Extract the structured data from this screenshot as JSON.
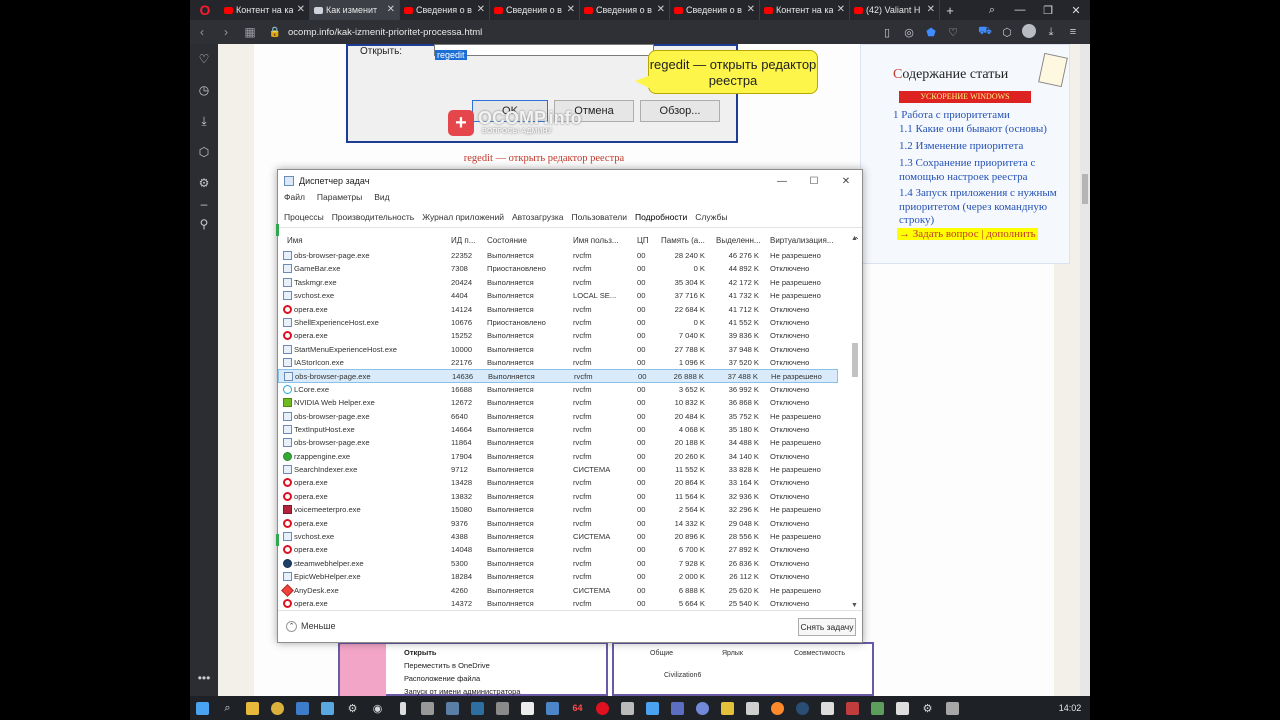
{
  "browser": {
    "tabs": [
      {
        "label": "Контент на ка",
        "kind": "youtube",
        "active": false
      },
      {
        "label": "Как изменит",
        "kind": "generic",
        "active": true
      },
      {
        "label": "Сведения о в",
        "kind": "youtube",
        "active": false
      },
      {
        "label": "Сведения о в",
        "kind": "youtube",
        "active": false
      },
      {
        "label": "Сведения о в",
        "kind": "youtube",
        "active": false
      },
      {
        "label": "Сведения о в",
        "kind": "youtube",
        "active": false
      },
      {
        "label": "Контент на ка",
        "kind": "youtube",
        "active": false
      },
      {
        "label": "(42) Valiant H",
        "kind": "youtube",
        "active": false
      }
    ],
    "url": "ocomp.info/kak-izmenit-prioritet-processa.html"
  },
  "article": {
    "run_dialog": {
      "open_label": "Открыть:",
      "input_value": "regedit",
      "ok_label": "OK",
      "cancel_label": "Отмена",
      "browse_label": "Обзор..."
    },
    "callout": "regedit — открыть редактор реестра",
    "watermark": {
      "name": "OCOMP.info",
      "sub": "ВОПРОСЫ АДМИНУ"
    },
    "caption": "regedit — открыть редактор реестра",
    "toc": {
      "title_first": "С",
      "title_rest": "одержание статьи",
      "banner": "УСКОРЕНИЕ WINDOWS",
      "items": [
        "1 Работа с приоритетами",
        "1.1 Какие они бывают (основы)",
        "1.2 Изменение приоритета",
        "1.3 Сохранение приоритета с помощью настроек реестра",
        "1.4 Запуск приложения с нужным приоритетом (через командную строку)"
      ],
      "ask": "→ Задать вопрос | дополнить"
    },
    "bottom_menu": [
      "Открыть",
      "Переместить в OneDrive",
      "Расположение файла",
      "Запуск от имени администратора"
    ],
    "bottom_tabs": [
      "Общие",
      "Ярлык",
      "Совместимость"
    ],
    "bottom_app": "Civilization6"
  },
  "task_manager": {
    "title": "Диспетчер задач",
    "menu": [
      "Файл",
      "Параметры",
      "Вид"
    ],
    "tabs": [
      "Процессы",
      "Производительность",
      "Журнал приложений",
      "Автозагрузка",
      "Пользователи",
      "Подробности",
      "Службы"
    ],
    "active_tab": "Подробности",
    "columns": [
      "Имя",
      "ИД п...",
      "Состояние",
      "Имя польз...",
      "ЦП",
      "Память (а...",
      "Выделенн...",
      "Виртуализация..."
    ],
    "rows": [
      {
        "name": "obs-browser-page.exe",
        "pid": "22352",
        "state": "Выполняется",
        "user": "rvcfm",
        "cpu": "00",
        "mem": "28 240 K",
        "commit": "46 276 K",
        "virt": "Не разрешено",
        "icon": "app"
      },
      {
        "name": "GameBar.exe",
        "pid": "7308",
        "state": "Приостановлено",
        "user": "rvcfm",
        "cpu": "00",
        "mem": "0 K",
        "commit": "44 892 K",
        "virt": "Отключено",
        "icon": "app"
      },
      {
        "name": "Taskmgr.exe",
        "pid": "20424",
        "state": "Выполняется",
        "user": "rvcfm",
        "cpu": "00",
        "mem": "35 304 K",
        "commit": "42 172 K",
        "virt": "Не разрешено",
        "icon": "app"
      },
      {
        "name": "svchost.exe",
        "pid": "4404",
        "state": "Выполняется",
        "user": "LOCAL SE...",
        "cpu": "00",
        "mem": "37 716 K",
        "commit": "41 732 K",
        "virt": "Не разрешено",
        "icon": "app"
      },
      {
        "name": "opera.exe",
        "pid": "14124",
        "state": "Выполняется",
        "user": "rvcfm",
        "cpu": "00",
        "mem": "22 684 K",
        "commit": "41 712 K",
        "virt": "Отключено",
        "icon": "opera"
      },
      {
        "name": "ShellExperienceHost.exe",
        "pid": "10676",
        "state": "Приостановлено",
        "user": "rvcfm",
        "cpu": "00",
        "mem": "0 K",
        "commit": "41 552 K",
        "virt": "Отключено",
        "icon": "app"
      },
      {
        "name": "opera.exe",
        "pid": "15252",
        "state": "Выполняется",
        "user": "rvcfm",
        "cpu": "00",
        "mem": "7 040 K",
        "commit": "39 836 K",
        "virt": "Отключено",
        "icon": "opera"
      },
      {
        "name": "StartMenuExperienceHost.exe",
        "pid": "10000",
        "state": "Выполняется",
        "user": "rvcfm",
        "cpu": "00",
        "mem": "27 788 K",
        "commit": "37 948 K",
        "virt": "Отключено",
        "icon": "app"
      },
      {
        "name": "IAStorIcon.exe",
        "pid": "22176",
        "state": "Выполняется",
        "user": "rvcfm",
        "cpu": "00",
        "mem": "1 096 K",
        "commit": "37 520 K",
        "virt": "Отключено",
        "icon": "app"
      },
      {
        "name": "obs-browser-page.exe",
        "pid": "14636",
        "state": "Выполняется",
        "user": "rvcfm",
        "cpu": "00",
        "mem": "26 888 K",
        "commit": "37 488 K",
        "virt": "Не разрешено",
        "icon": "app",
        "selected": true
      },
      {
        "name": "LCore.exe",
        "pid": "16688",
        "state": "Выполняется",
        "user": "rvcfm",
        "cpu": "00",
        "mem": "3 652 K",
        "commit": "36 992 K",
        "virt": "Отключено",
        "icon": "lcore"
      },
      {
        "name": "NVIDIA Web Helper.exe",
        "pid": "12672",
        "state": "Выполняется",
        "user": "rvcfm",
        "cpu": "00",
        "mem": "10 832 K",
        "commit": "36 868 K",
        "virt": "Отключено",
        "icon": "nvidia"
      },
      {
        "name": "obs-browser-page.exe",
        "pid": "6640",
        "state": "Выполняется",
        "user": "rvcfm",
        "cpu": "00",
        "mem": "20 484 K",
        "commit": "35 752 K",
        "virt": "Не разрешено",
        "icon": "app"
      },
      {
        "name": "TextInputHost.exe",
        "pid": "14664",
        "state": "Выполняется",
        "user": "rvcfm",
        "cpu": "00",
        "mem": "4 068 K",
        "commit": "35 180 K",
        "virt": "Отключено",
        "icon": "app"
      },
      {
        "name": "obs-browser-page.exe",
        "pid": "11864",
        "state": "Выполняется",
        "user": "rvcfm",
        "cpu": "00",
        "mem": "20 188 K",
        "commit": "34 488 K",
        "virt": "Не разрешено",
        "icon": "app"
      },
      {
        "name": "rzappengine.exe",
        "pid": "17904",
        "state": "Выполняется",
        "user": "rvcfm",
        "cpu": "00",
        "mem": "20 260 K",
        "commit": "34 140 K",
        "virt": "Отключено",
        "icon": "green"
      },
      {
        "name": "SearchIndexer.exe",
        "pid": "9712",
        "state": "Выполняется",
        "user": "СИСТЕМА",
        "cpu": "00",
        "mem": "11 552 K",
        "commit": "33 828 K",
        "virt": "Не разрешено",
        "icon": "app"
      },
      {
        "name": "opera.exe",
        "pid": "13428",
        "state": "Выполняется",
        "user": "rvcfm",
        "cpu": "00",
        "mem": "20 864 K",
        "commit": "33 164 K",
        "virt": "Отключено",
        "icon": "opera"
      },
      {
        "name": "opera.exe",
        "pid": "13832",
        "state": "Выполняется",
        "user": "rvcfm",
        "cpu": "00",
        "mem": "11 564 K",
        "commit": "32 936 K",
        "virt": "Отключено",
        "icon": "opera"
      },
      {
        "name": "voicemeeterpro.exe",
        "pid": "15080",
        "state": "Выполняется",
        "user": "rvcfm",
        "cpu": "00",
        "mem": "2 564 K",
        "commit": "32 296 K",
        "virt": "Не разрешено",
        "icon": "red"
      },
      {
        "name": "opera.exe",
        "pid": "9376",
        "state": "Выполняется",
        "user": "rvcfm",
        "cpu": "00",
        "mem": "14 332 K",
        "commit": "29 048 K",
        "virt": "Отключено",
        "icon": "opera"
      },
      {
        "name": "svchost.exe",
        "pid": "4388",
        "state": "Выполняется",
        "user": "СИСТЕМА",
        "cpu": "00",
        "mem": "20 896 K",
        "commit": "28 556 K",
        "virt": "Не разрешено",
        "icon": "app"
      },
      {
        "name": "opera.exe",
        "pid": "14048",
        "state": "Выполняется",
        "user": "rvcfm",
        "cpu": "00",
        "mem": "6 700 K",
        "commit": "27 892 K",
        "virt": "Отключено",
        "icon": "opera"
      },
      {
        "name": "steamwebhelper.exe",
        "pid": "5300",
        "state": "Выполняется",
        "user": "rvcfm",
        "cpu": "00",
        "mem": "7 928 K",
        "commit": "26 836 K",
        "virt": "Отключено",
        "icon": "steam"
      },
      {
        "name": "EpicWebHelper.exe",
        "pid": "18284",
        "state": "Выполняется",
        "user": "rvcfm",
        "cpu": "00",
        "mem": "2 000 K",
        "commit": "26 112 K",
        "virt": "Отключено",
        "icon": "app"
      },
      {
        "name": "AnyDesk.exe",
        "pid": "4260",
        "state": "Выполняется",
        "user": "СИСТЕМА",
        "cpu": "00",
        "mem": "6 888 K",
        "commit": "25 620 K",
        "virt": "Не разрешено",
        "icon": "anydesk"
      },
      {
        "name": "opera.exe",
        "pid": "14372",
        "state": "Выполняется",
        "user": "rvcfm",
        "cpu": "00",
        "mem": "5 664 K",
        "commit": "25 540 K",
        "virt": "Отключено",
        "icon": "opera"
      }
    ],
    "less_label": "Меньше",
    "end_task_label": "Снять задачу"
  },
  "taskbar": {
    "clock": "14:02",
    "badge": "64"
  },
  "colors": {
    "selection": "#d9ebfa",
    "opera_red": "#ff1b2d",
    "callout_yellow": "#fdf54a",
    "caption_red": "#c0392b"
  }
}
